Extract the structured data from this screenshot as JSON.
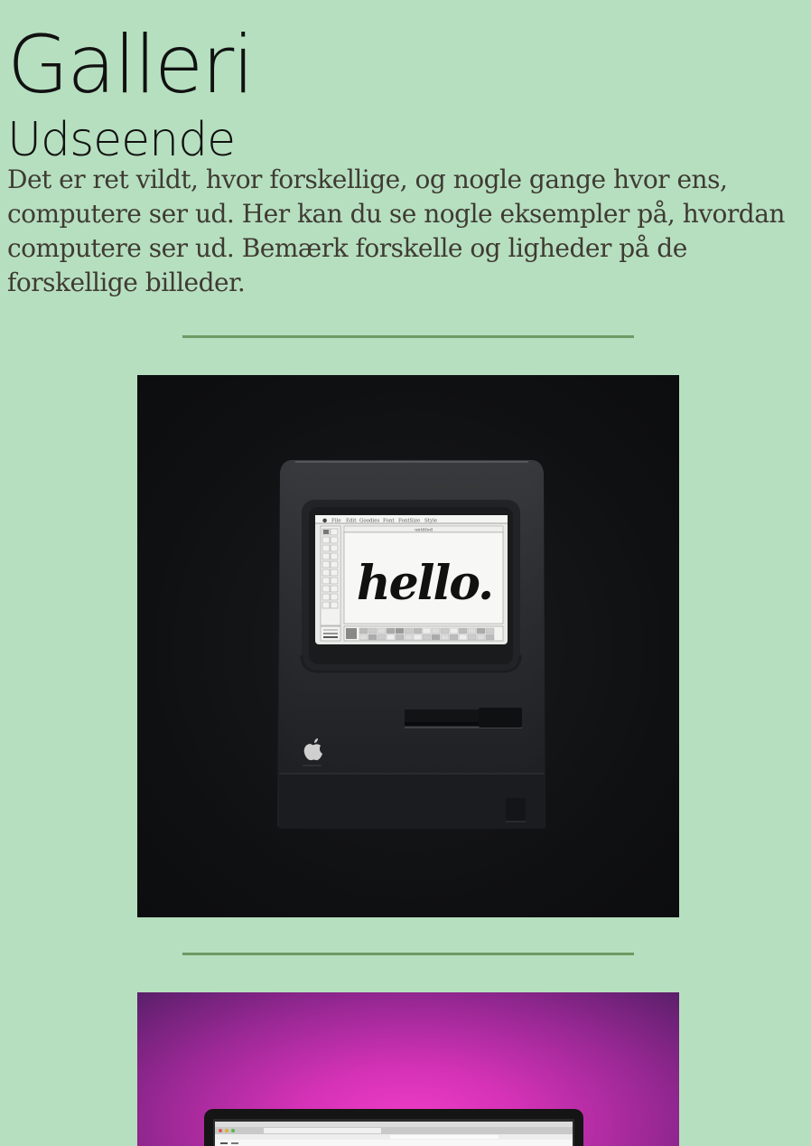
{
  "header": {
    "title": "Galleri",
    "subtitle": "Udseende",
    "intro": "Det er ret vildt, hvor forskellige, og nogle gange hvor ens, computere ser ud. Her kan du se nogle eksempler på, hvordan computere ser ud. Bemærk forskelle og ligheder på de forskellige billeder."
  },
  "gallery": {
    "items": [
      {
        "screen_text": "hello.",
        "menu_items": [
          "File",
          "Edit",
          "Goodies",
          "Font",
          "FontSize",
          "Style"
        ],
        "window_title": "untitled"
      },
      {
        "description_icon": "laptop-icon"
      }
    ]
  },
  "colors": {
    "background": "#b6dfbf",
    "divider": "#6d9b64",
    "body_text": "#3f3b33"
  }
}
